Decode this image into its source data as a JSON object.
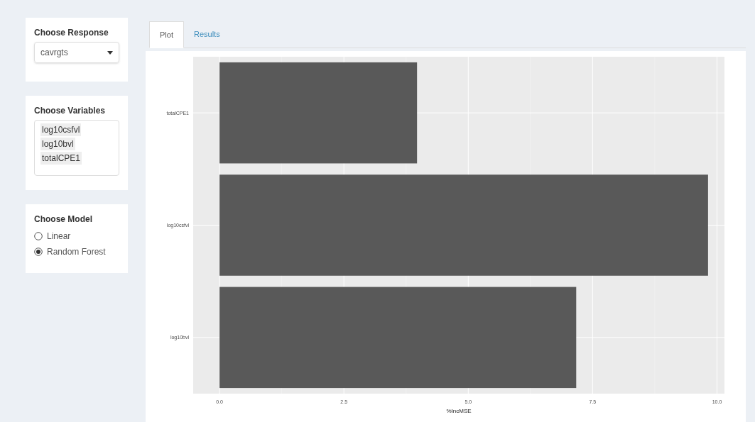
{
  "sidebar": {
    "response": {
      "label": "Choose Response",
      "value": "cavrgts"
    },
    "variables": {
      "label": "Choose Variables",
      "items": [
        "log10csfvl",
        "log10bvl",
        "totalCPE1"
      ]
    },
    "model": {
      "label": "Choose Model",
      "options": [
        {
          "label": "Linear",
          "selected": false
        },
        {
          "label": "Random Forest",
          "selected": true
        }
      ]
    }
  },
  "tabs": [
    {
      "label": "Plot",
      "selected": true
    },
    {
      "label": "Results",
      "selected": false
    }
  ],
  "chart_data": {
    "type": "bar",
    "orientation": "horizontal",
    "xlabel": "%IncMSE",
    "categories": [
      "totalCPE1",
      "log10csfvl",
      "log10bvl"
    ],
    "series": [
      {
        "color": "#595959",
        "values": [
          3.97,
          9.82,
          7.17
        ]
      }
    ],
    "grid": true,
    "xlim": [
      -0.53,
      10.15
    ],
    "xticks": [
      {
        "value": 0,
        "label": "0.0"
      },
      {
        "value": 2.5,
        "label": "2.5"
      },
      {
        "value": 5,
        "label": "5.0"
      },
      {
        "value": 7.5,
        "label": "7.5"
      },
      {
        "value": 10,
        "label": "10.0"
      }
    ]
  }
}
